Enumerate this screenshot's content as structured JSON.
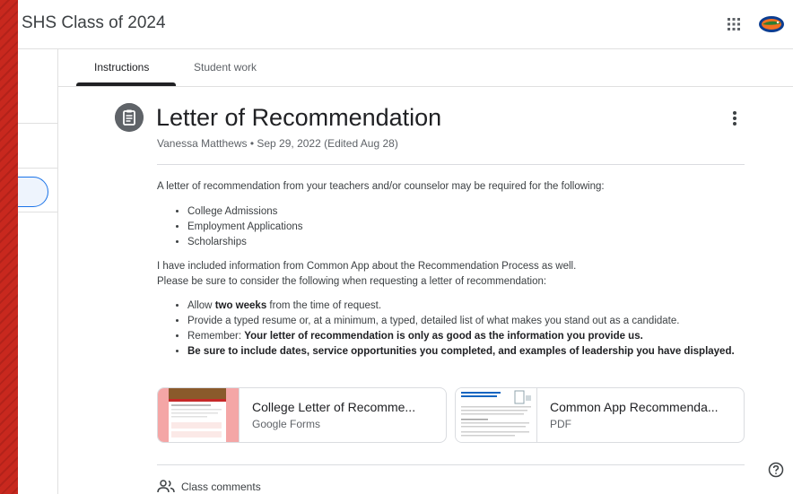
{
  "header": {
    "class_title": "SHS Class of 2024",
    "apps_icon": "apps-grid-icon",
    "avatar": "gator-logo"
  },
  "tabs": [
    {
      "label": "Instructions",
      "active": true
    },
    {
      "label": "Student work",
      "active": false
    }
  ],
  "assignment": {
    "icon": "assignment-icon",
    "title": "Letter of Recommendation",
    "meta": "Vanessa Matthews • Sep 29, 2022 (Edited Aug 28)",
    "intro": "A letter of recommendation from your teachers and/or counselor may be required for the following:",
    "list1": [
      "College Admissions",
      "Employment Applications",
      "Scholarships"
    ],
    "para2_line1": "I have included information from Common App about the Recommendation Process as well.",
    "para2_line2": "Please be sure to consider the following when requesting a letter of recommendation:",
    "list2": {
      "item1_pre": "Allow ",
      "item1_bold": "two weeks",
      "item1_post": " from the time of request.",
      "item2": "Provide a typed resume or, at a minimum, a typed, detailed list of what makes you stand out as a candidate.",
      "item3_pre": "Remember: ",
      "item3_bold": "Your letter of recommendation is only as good as the information you provide us.",
      "item4_bold": "Be sure to include dates, service opportunities you completed, and examples of leadership you have displayed."
    }
  },
  "attachments": [
    {
      "title": "College Letter of Recomme...",
      "type": "Google Forms",
      "thumb_color": "#f4a6a6"
    },
    {
      "title": "Common App Recommenda...",
      "type": "PDF",
      "thumb_color": "#ffffff"
    }
  ],
  "comments": {
    "label": "Class comments",
    "icon": "people-icon"
  },
  "help_icon": "help-icon",
  "colors": {
    "accent": "#1a73e8",
    "background_red": "#c8281e",
    "text": "#202124"
  }
}
